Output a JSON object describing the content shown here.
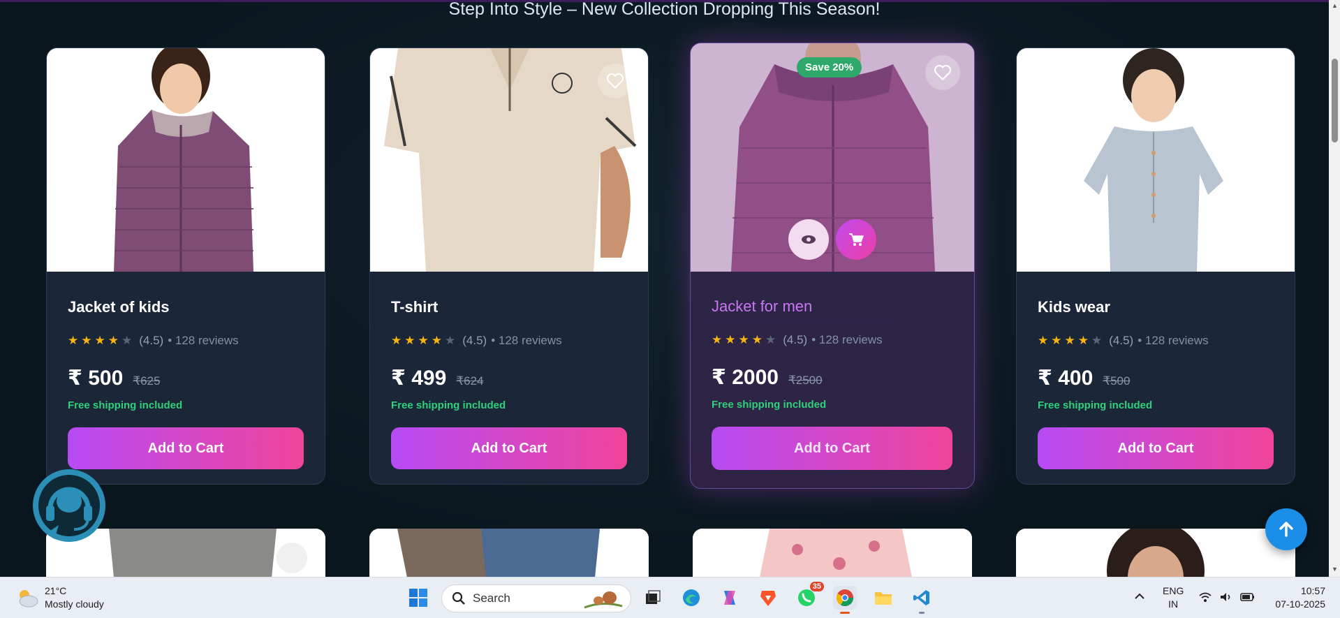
{
  "headline": "Step Into Style – New Collection Dropping This Season!",
  "products": [
    {
      "title": "Jacket of kids",
      "rating": "(4.5)",
      "reviews": "• 128 reviews",
      "price": "₹ 500",
      "old_price": "₹625",
      "shipping": "Free shipping included",
      "button": "Add to Cart",
      "stars_filled": 4
    },
    {
      "title": "T-shirt",
      "rating": "(4.5)",
      "reviews": "• 128 reviews",
      "price": "₹ 499",
      "old_price": "₹624",
      "shipping": "Free shipping included",
      "button": "Add to Cart",
      "stars_filled": 4
    },
    {
      "title": "Jacket for men",
      "rating": "(4.5)",
      "reviews": "• 128 reviews",
      "price": "₹ 2000",
      "old_price": "₹2500",
      "shipping": "Free shipping included",
      "button": "Add to Cart",
      "badge": "Save 20%",
      "stars_filled": 4
    },
    {
      "title": "Kids wear",
      "rating": "(4.5)",
      "reviews": "• 128 reviews",
      "price": "₹ 400",
      "old_price": "₹500",
      "shipping": "Free shipping included",
      "button": "Add to Cart",
      "stars_filled": 4
    }
  ],
  "colors": {
    "accent_gradient_start": "#b64bf4",
    "accent_gradient_end": "#f0449a",
    "shipping_green": "#2fd27a",
    "star": "#f5b512",
    "badge_green": "#2fa86b",
    "scroll_top_blue": "#1b8fe8"
  },
  "icons": [
    "heart-icon",
    "eye-icon",
    "cart-icon",
    "support-headset-icon",
    "arrow-up-icon"
  ],
  "taskbar": {
    "weather_temp": "21°C",
    "weather_desc": "Mostly cloudy",
    "search_placeholder": "Search",
    "whatsapp_badge": "35",
    "lang_top": "ENG",
    "lang_bottom": "IN",
    "time": "10:57",
    "date": "07-10-2025"
  }
}
